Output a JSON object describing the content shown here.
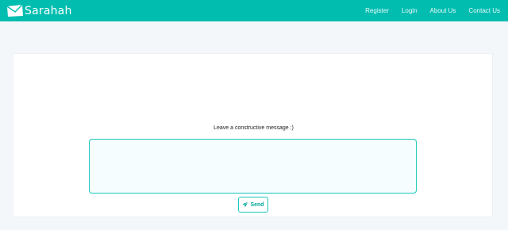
{
  "navbar": {
    "brand": "Sarahah",
    "brand_icon": "envelope-icon",
    "links": [
      "Register",
      "Login",
      "About Us",
      "Contact Us"
    ],
    "background": "#00bdb0"
  },
  "main": {
    "prompt": "Leave a constructive message :)",
    "message_value": "",
    "message_placeholder": "",
    "send_label": "Send",
    "send_icon": "paper-plane-icon",
    "accent": "#19c7bb"
  }
}
